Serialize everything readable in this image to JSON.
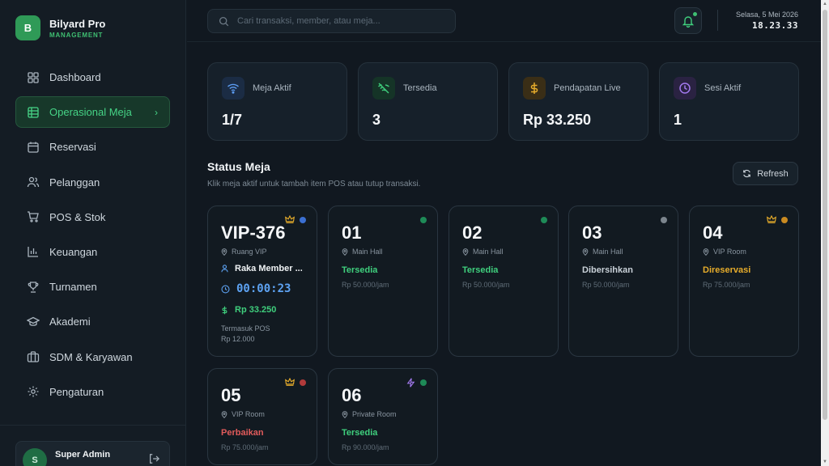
{
  "brand": {
    "logo_letter": "B",
    "name": "Bilyard Pro",
    "subtitle": "MANAGEMENT"
  },
  "sidebar": {
    "items": [
      {
        "label": "Dashboard",
        "icon": "dashboard-grid-icon",
        "active": false
      },
      {
        "label": "Operasional Meja",
        "icon": "table-grid-icon",
        "active": true
      },
      {
        "label": "Reservasi",
        "icon": "calendar-icon",
        "active": false
      },
      {
        "label": "Pelanggan",
        "icon": "users-icon",
        "active": false
      },
      {
        "label": "POS & Stok",
        "icon": "cart-icon",
        "active": false
      },
      {
        "label": "Keuangan",
        "icon": "bar-chart-icon",
        "active": false
      },
      {
        "label": "Turnamen",
        "icon": "trophy-icon",
        "active": false
      },
      {
        "label": "Akademi",
        "icon": "graduation-cap-icon",
        "active": false
      },
      {
        "label": "SDM & Karyawan",
        "icon": "briefcase-icon",
        "active": false
      },
      {
        "label": "Pengaturan",
        "icon": "gear-icon",
        "active": false
      }
    ],
    "user": {
      "initial": "S",
      "name": "Super Admin"
    }
  },
  "header": {
    "search_placeholder": "Cari transaksi, member, atau meja...",
    "date": "Selasa, 5 Mei 2026",
    "time": "18.23.33"
  },
  "stats": [
    {
      "label": "Meja Aktif",
      "value": "1/7",
      "icon": "wifi-icon",
      "color": "#5b9bf0"
    },
    {
      "label": "Tersedia",
      "value": "3",
      "icon": "wifi-off-icon",
      "color": "#3fcf7d"
    },
    {
      "label": "Pendapatan Live",
      "value": "Rp 33.250",
      "icon": "dollar-icon",
      "color": "#e6ac2b"
    },
    {
      "label": "Sesi Aktif",
      "value": "1",
      "icon": "clock-icon",
      "color": "#a279ee"
    }
  ],
  "section": {
    "title": "Status Meja",
    "subtitle": "Klik meja aktif untuk tambah item POS atau tutup transaksi.",
    "refresh_label": "Refresh"
  },
  "tables": [
    {
      "name": "VIP-376",
      "location": "Ruang VIP",
      "dot_color": "#3b6fd1",
      "badge": "crown-icon",
      "member": "Raka Member ...",
      "timer": "00:00:23",
      "amount": "Rp 33.250",
      "pos_label": "Termasuk POS",
      "pos_value": "Rp 12.000"
    },
    {
      "name": "01",
      "location": "Main Hall",
      "status": "Tersedia",
      "rate": "Rp 50.000/jam",
      "dot_color": "#1e8a57"
    },
    {
      "name": "02",
      "location": "Main Hall",
      "status": "Tersedia",
      "rate": "Rp 50.000/jam",
      "dot_color": "#1e8a57"
    },
    {
      "name": "03",
      "location": "Main Hall",
      "status": "Dibersihkan",
      "rate": "Rp 50.000/jam",
      "dot_color": "#7c858d"
    },
    {
      "name": "04",
      "location": "VIP Room",
      "status": "Direservasi",
      "rate": "Rp 75.000/jam",
      "dot_color": "#c98a21",
      "badge": "crown-icon"
    },
    {
      "name": "05",
      "location": "VIP Room",
      "status": "Perbaikan",
      "rate": "Rp 75.000/jam",
      "dot_color": "#b23b3b",
      "badge": "crown-icon"
    },
    {
      "name": "06",
      "location": "Private Room",
      "status": "Tersedia",
      "rate": "Rp 90.000/jam",
      "dot_color": "#1e8a57",
      "badge": "lightning-icon"
    }
  ]
}
